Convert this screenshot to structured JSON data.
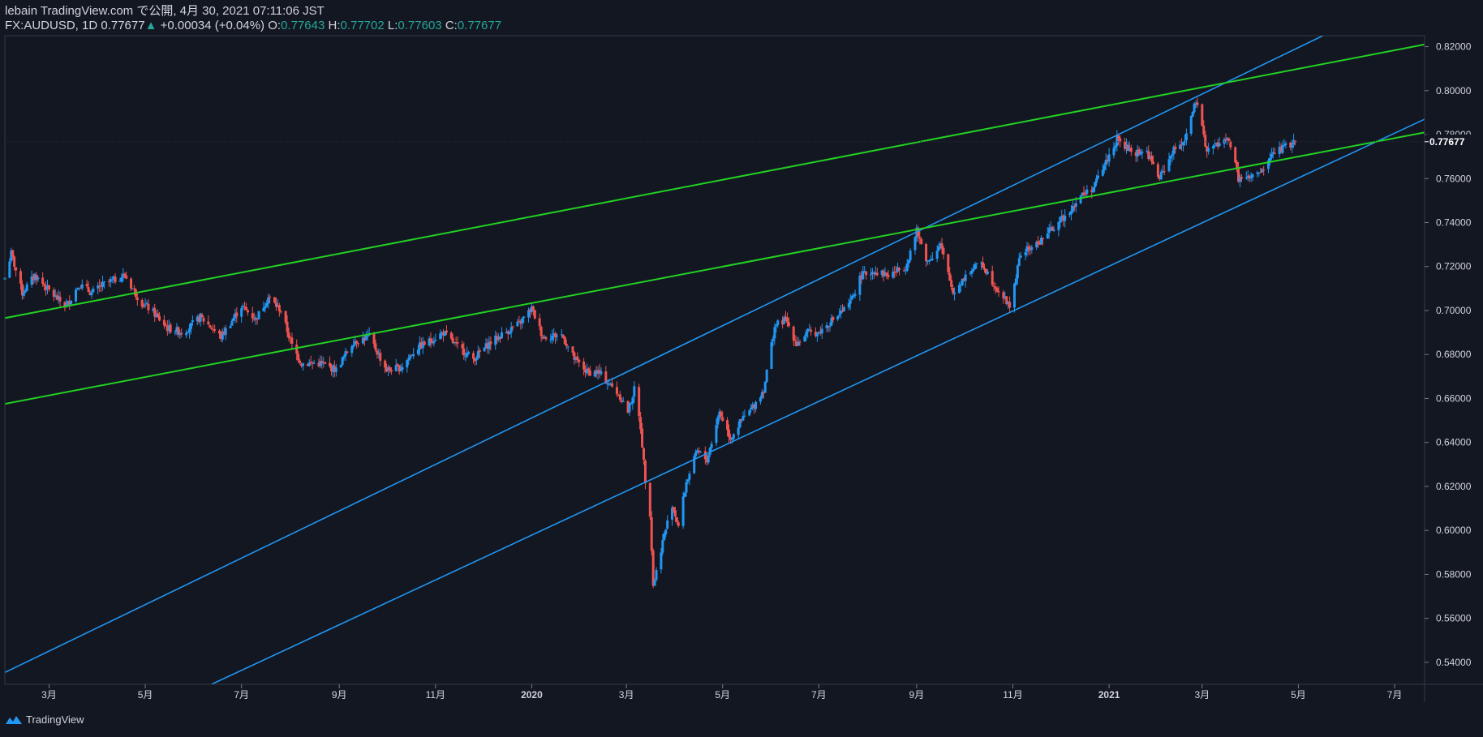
{
  "header": {
    "published": "lebain TradingView.com で公開, 4月 30, 2021 07:11:06 JST",
    "symbol": "FX:AUDUSD, 1D",
    "last": "0.77677",
    "change": "+0.00034 (+0.04%)",
    "o_label": "O:",
    "o_value": "0.77643",
    "h_label": "H:",
    "h_value": "0.77702",
    "l_label": "L:",
    "l_value": "0.77603",
    "c_label": "C:",
    "c_value": "0.77677"
  },
  "footer": {
    "brand": "TradingView"
  },
  "colors": {
    "background": "#131722",
    "up_candle": "#2196f3",
    "down_candle": "#ef5350",
    "channel_line": "#2196f3",
    "trend_line": "#22d122",
    "axis_text": "#d1d4dc"
  },
  "chart_data": {
    "type": "candlestick",
    "symbol": "FX:AUDUSD",
    "interval": "1D",
    "last_price_label": "0.77677",
    "ylim": [
      0.53,
      0.825
    ],
    "y_ticks": [
      "0.54000",
      "0.56000",
      "0.58000",
      "0.60000",
      "0.62000",
      "0.64000",
      "0.66000",
      "0.68000",
      "0.70000",
      "0.72000",
      "0.74000",
      "0.76000",
      "0.78000",
      "0.80000",
      "0.82000"
    ],
    "x_ticks": [
      {
        "label": "3月",
        "date": "2019-03-01"
      },
      {
        "label": "5月",
        "date": "2019-05-01"
      },
      {
        "label": "7月",
        "date": "2019-07-01"
      },
      {
        "label": "9月",
        "date": "2019-09-01"
      },
      {
        "label": "11月",
        "date": "2019-11-01"
      },
      {
        "label": "2020",
        "date": "2020-01-01"
      },
      {
        "label": "3月",
        "date": "2020-03-01"
      },
      {
        "label": "5月",
        "date": "2020-05-01"
      },
      {
        "label": "7月",
        "date": "2020-07-01"
      },
      {
        "label": "9月",
        "date": "2020-09-01"
      },
      {
        "label": "11月",
        "date": "2020-11-01"
      },
      {
        "label": "2021",
        "date": "2021-01-01"
      },
      {
        "label": "3月",
        "date": "2021-03-01"
      },
      {
        "label": "5月",
        "date": "2021-05-01"
      },
      {
        "label": "7月",
        "date": "2021-07-01"
      }
    ],
    "x_range": [
      "2019-02-01",
      "2021-07-20"
    ],
    "price_path": [
      [
        "2019-02-01",
        0.715
      ],
      [
        "2019-02-05",
        0.726
      ],
      [
        "2019-02-12",
        0.708
      ],
      [
        "2019-02-20",
        0.716
      ],
      [
        "2019-03-05",
        0.706
      ],
      [
        "2019-03-12",
        0.702
      ],
      [
        "2019-03-20",
        0.712
      ],
      [
        "2019-03-28",
        0.708
      ],
      [
        "2019-04-05",
        0.712
      ],
      [
        "2019-04-18",
        0.716
      ],
      [
        "2019-04-28",
        0.704
      ],
      [
        "2019-05-05",
        0.7
      ],
      [
        "2019-05-15",
        0.692
      ],
      [
        "2019-05-25",
        0.69
      ],
      [
        "2019-06-05",
        0.697
      ],
      [
        "2019-06-18",
        0.688
      ],
      [
        "2019-07-01",
        0.702
      ],
      [
        "2019-07-10",
        0.696
      ],
      [
        "2019-07-18",
        0.706
      ],
      [
        "2019-07-26",
        0.7
      ],
      [
        "2019-08-02",
        0.684
      ],
      [
        "2019-08-08",
        0.676
      ],
      [
        "2019-08-20",
        0.676
      ],
      [
        "2019-08-30",
        0.673
      ],
      [
        "2019-09-10",
        0.686
      ],
      [
        "2019-09-20",
        0.688
      ],
      [
        "2019-10-01",
        0.673
      ],
      [
        "2019-10-10",
        0.674
      ],
      [
        "2019-10-20",
        0.683
      ],
      [
        "2019-10-28",
        0.686
      ],
      [
        "2019-11-06",
        0.69
      ],
      [
        "2019-11-14",
        0.684
      ],
      [
        "2019-11-25",
        0.678
      ],
      [
        "2019-12-05",
        0.685
      ],
      [
        "2019-12-15",
        0.69
      ],
      [
        "2019-12-24",
        0.694
      ],
      [
        "2020-01-01",
        0.701
      ],
      [
        "2020-01-08",
        0.688
      ],
      [
        "2020-01-20",
        0.689
      ],
      [
        "2020-01-28",
        0.678
      ],
      [
        "2020-02-05",
        0.672
      ],
      [
        "2020-02-12",
        0.672
      ],
      [
        "2020-02-20",
        0.666
      ],
      [
        "2020-02-26",
        0.661
      ],
      [
        "2020-03-02",
        0.654
      ],
      [
        "2020-03-06",
        0.664
      ],
      [
        "2020-03-10",
        0.647
      ],
      [
        "2020-03-13",
        0.623
      ],
      [
        "2020-03-16",
        0.608
      ],
      [
        "2020-03-18",
        0.575
      ],
      [
        "2020-03-19",
        0.578
      ],
      [
        "2020-03-24",
        0.595
      ],
      [
        "2020-03-30",
        0.612
      ],
      [
        "2020-04-03",
        0.602
      ],
      [
        "2020-04-08",
        0.622
      ],
      [
        "2020-04-15",
        0.636
      ],
      [
        "2020-04-21",
        0.632
      ],
      [
        "2020-04-29",
        0.654
      ],
      [
        "2020-05-06",
        0.642
      ],
      [
        "2020-05-13",
        0.65
      ],
      [
        "2020-05-20",
        0.656
      ],
      [
        "2020-05-27",
        0.664
      ],
      [
        "2020-06-03",
        0.693
      ],
      [
        "2020-06-10",
        0.696
      ],
      [
        "2020-06-17",
        0.685
      ],
      [
        "2020-06-24",
        0.69
      ],
      [
        "2020-07-01",
        0.69
      ],
      [
        "2020-07-10",
        0.696
      ],
      [
        "2020-07-20",
        0.702
      ],
      [
        "2020-07-28",
        0.716
      ],
      [
        "2020-08-05",
        0.718
      ],
      [
        "2020-08-14",
        0.716
      ],
      [
        "2020-08-25",
        0.72
      ],
      [
        "2020-09-01",
        0.736
      ],
      [
        "2020-09-08",
        0.722
      ],
      [
        "2020-09-16",
        0.73
      ],
      [
        "2020-09-24",
        0.708
      ],
      [
        "2020-10-02",
        0.716
      ],
      [
        "2020-10-12",
        0.722
      ],
      [
        "2020-10-20",
        0.712
      ],
      [
        "2020-10-30",
        0.702
      ],
      [
        "2020-11-06",
        0.726
      ],
      [
        "2020-11-16",
        0.73
      ],
      [
        "2020-11-24",
        0.736
      ],
      [
        "2020-12-04",
        0.743
      ],
      [
        "2020-12-14",
        0.752
      ],
      [
        "2020-12-22",
        0.756
      ],
      [
        "2020-12-31",
        0.769
      ],
      [
        "2021-01-06",
        0.778
      ],
      [
        "2021-01-15",
        0.772
      ],
      [
        "2021-01-25",
        0.772
      ],
      [
        "2021-02-02",
        0.76
      ],
      [
        "2021-02-10",
        0.772
      ],
      [
        "2021-02-18",
        0.778
      ],
      [
        "2021-02-25",
        0.795
      ],
      [
        "2021-03-04",
        0.773
      ],
      [
        "2021-03-12",
        0.776
      ],
      [
        "2021-03-18",
        0.778
      ],
      [
        "2021-03-24",
        0.76
      ],
      [
        "2021-03-31",
        0.76
      ],
      [
        "2021-04-08",
        0.763
      ],
      [
        "2021-04-15",
        0.772
      ],
      [
        "2021-04-22",
        0.774
      ],
      [
        "2021-04-29",
        0.7768
      ]
    ],
    "lines": [
      {
        "name": "upper-channel",
        "from": [
          "2019-01-28",
          0.534
        ],
        "to": [
          "2021-05-31",
          0.83
        ]
      },
      {
        "name": "lower-channel",
        "from": [
          "2019-06-12",
          0.53
        ],
        "to": [
          "2021-07-20",
          0.787
        ]
      },
      {
        "name": "upper-trend",
        "from": [
          "2019-01-28",
          0.696
        ],
        "to": [
          "2021-07-20",
          0.821
        ]
      },
      {
        "name": "lower-trend",
        "from": [
          "2019-01-28",
          0.657
        ],
        "to": [
          "2021-07-20",
          0.781
        ]
      }
    ]
  }
}
